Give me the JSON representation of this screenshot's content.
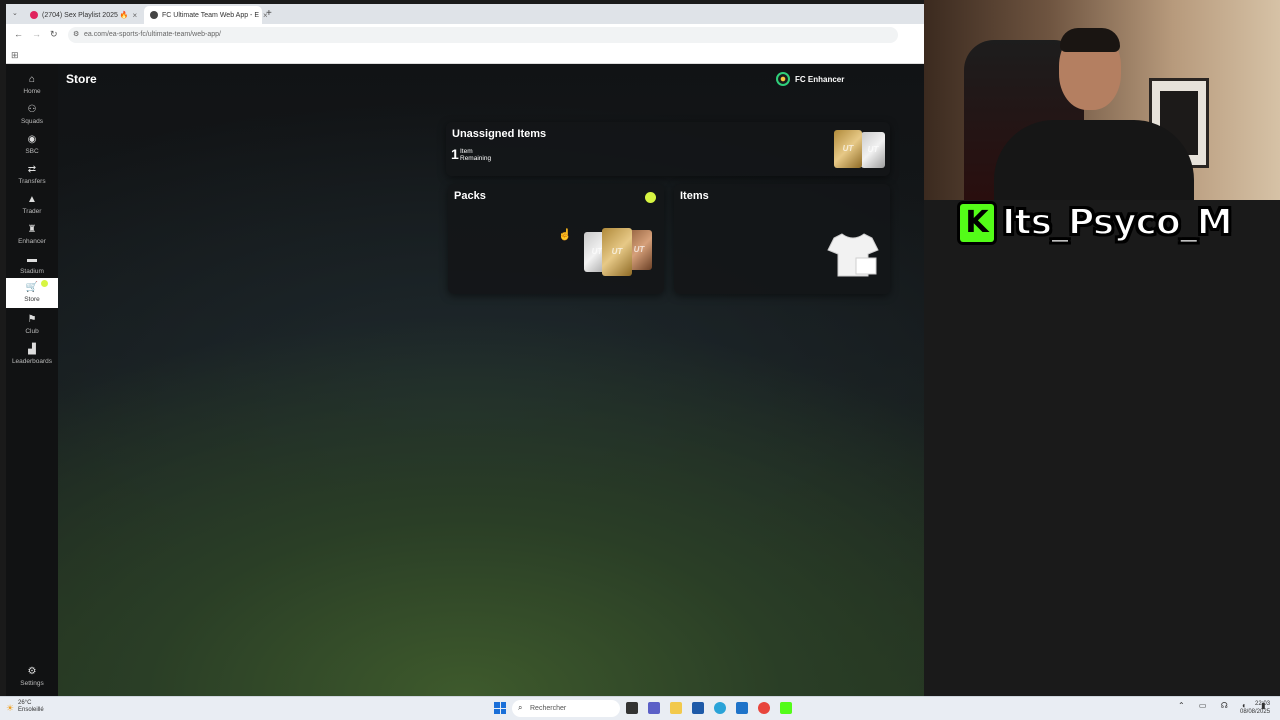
{
  "browser": {
    "tabs": [
      {
        "label": "(2704) Sex Playlist 2025 🔥",
        "favicon": "youtube-icon",
        "color": "#e0245e"
      },
      {
        "label": "FC Ultimate Team Web App - E",
        "favicon": "ea-icon",
        "color": "#444444"
      }
    ],
    "url": "ea.com/ea-sports-fc/ultimate-team/web-app/"
  },
  "sidebar": {
    "items": [
      {
        "label": "Home",
        "icon": "home-icon",
        "glyph": "⌂"
      },
      {
        "label": "Squads",
        "icon": "squads-icon",
        "glyph": "⚇"
      },
      {
        "label": "SBC",
        "icon": "sbc-icon",
        "glyph": "◉"
      },
      {
        "label": "Transfers",
        "icon": "transfers-icon",
        "glyph": "⇄"
      },
      {
        "label": "Trader",
        "icon": "trader-icon",
        "glyph": "▲"
      },
      {
        "label": "Enhancer",
        "icon": "enhancer-icon",
        "glyph": "♜"
      },
      {
        "label": "Stadium",
        "icon": "stadium-icon",
        "glyph": "▬"
      },
      {
        "label": "Store",
        "icon": "store-icon",
        "glyph": "🛒"
      },
      {
        "label": "Club",
        "icon": "club-icon",
        "glyph": "⚑"
      },
      {
        "label": "Leaderboards",
        "icon": "leaderboards-icon",
        "glyph": "▟"
      }
    ],
    "settings": {
      "label": "Settings",
      "icon": "gear-icon",
      "glyph": "⚙"
    },
    "active": "Store"
  },
  "header": {
    "title": "Store",
    "extension": "FC Enhancer"
  },
  "tiles": {
    "unassigned": {
      "title": "Unassigned Items",
      "count": "1",
      "sub1": "Item",
      "sub2": "Remaining"
    },
    "packs": {
      "title": "Packs"
    },
    "items": {
      "title": "Items"
    }
  },
  "pack_label": "UT",
  "stream": {
    "name": "Its_Psyco_M",
    "platform_icon": "K"
  },
  "taskbar": {
    "weather_temp": "26°C",
    "weather_desc": "Ensoleillé",
    "search_placeholder": "Rechercher",
    "time": "22:03",
    "date": "08/08/2025"
  },
  "colors": {
    "accent": "#d7f542",
    "kick": "#53fc18",
    "enhancer": "#2fcf7a"
  }
}
